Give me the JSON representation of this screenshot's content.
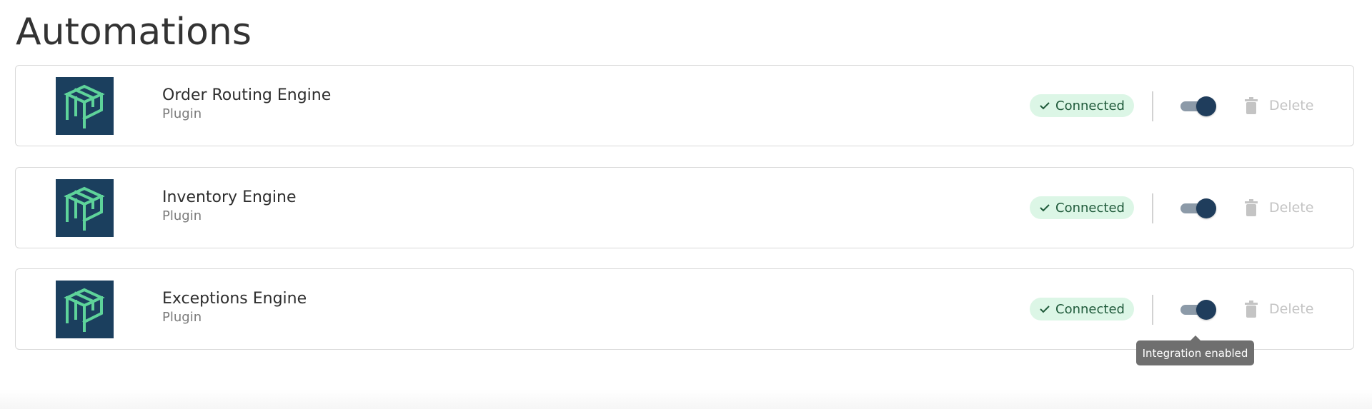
{
  "page": {
    "title": "Automations"
  },
  "integrations": [
    {
      "name": "Order Routing Engine",
      "type": "Plugin",
      "status": "Connected",
      "enabled": true,
      "delete_label": "Delete",
      "logo_icon": "package-box-icon"
    },
    {
      "name": "Inventory Engine",
      "type": "Plugin",
      "status": "Connected",
      "enabled": true,
      "delete_label": "Delete",
      "logo_icon": "package-box-icon"
    },
    {
      "name": "Exceptions Engine",
      "type": "Plugin",
      "status": "Connected",
      "enabled": true,
      "delete_label": "Delete",
      "logo_icon": "package-box-icon"
    }
  ],
  "tooltip": {
    "text": "Integration enabled"
  },
  "colors": {
    "logo_background": "#1b3f5e",
    "logo_foreground": "#5ed39a",
    "connected_badge_bg": "#dcf6e6",
    "connected_badge_text": "#1f5a3a",
    "toggle_knob": "#1f3d5c",
    "toggle_track": "#8c9aa8",
    "delete_disabled": "#c4c4c4",
    "tooltip_bg": "#6f6f6f"
  }
}
